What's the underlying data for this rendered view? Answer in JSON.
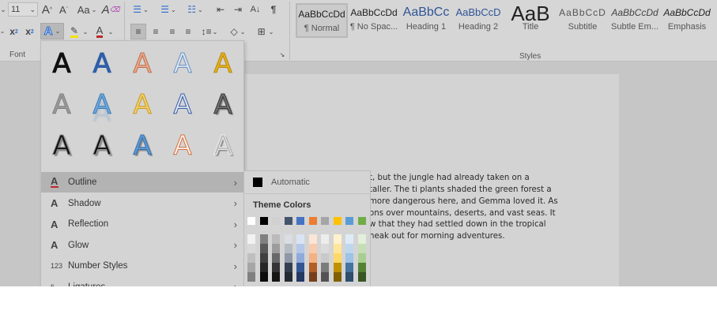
{
  "ribbon": {
    "font_size": "11",
    "font_group_label": "Font",
    "styles_group_label": "Styles",
    "change_case_label": "Aa",
    "styles": [
      {
        "preview": "AaBbCcDd",
        "name": "¶ Normal",
        "selected": true
      },
      {
        "preview": "AaBbCcDd",
        "name": "¶ No Spac..."
      },
      {
        "preview": "AaBbCc",
        "name": "Heading 1"
      },
      {
        "preview": "AaBbCcD",
        "name": "Heading 2"
      },
      {
        "preview": "AaB",
        "name": "Title"
      },
      {
        "preview": "AaBbCcD",
        "name": "Subtitle"
      },
      {
        "preview": "AaBbCcDd",
        "name": "Subtle Em..."
      },
      {
        "preview": "AaBbCcDd",
        "name": "Emphasis"
      }
    ],
    "highlight_color": "#f2e200",
    "font_color": "#c0262d"
  },
  "text_effects": {
    "gallery_glyph": "A",
    "menu": [
      {
        "label": "Outline",
        "icon": "outline-icon",
        "highlighted": true
      },
      {
        "label": "Shadow",
        "icon": "shadow-icon"
      },
      {
        "label": "Reflection",
        "icon": "reflection-icon"
      },
      {
        "label": "Glow",
        "icon": "glow-icon"
      },
      {
        "label": "Number Styles",
        "icon": "number-styles-icon",
        "icon_text": "123"
      },
      {
        "label": "Ligatures",
        "icon": "ligatures-icon",
        "icon_text": "fi"
      }
    ]
  },
  "outline_submenu": {
    "automatic_label": "Automatic",
    "theme_colors_label": "Theme Colors",
    "theme_colors": [
      "#ffffff",
      "#000000",
      "#d0d0d0",
      "#44546a",
      "#4472c4",
      "#ed7d31",
      "#a5a5a5",
      "#ffc000",
      "#5b9bd5",
      "#70ad47"
    ]
  },
  "document": {
    "lines": [
      "t, but the jungle had already taken on a",
      "taller. The ti plants shaded the green forest a",
      "more dangerous here, and Gemma loved it. As",
      "ons over mountains, deserts, and vast seas. It",
      "w that they had settled down in the tropical",
      "neak out for morning adventures."
    ]
  }
}
